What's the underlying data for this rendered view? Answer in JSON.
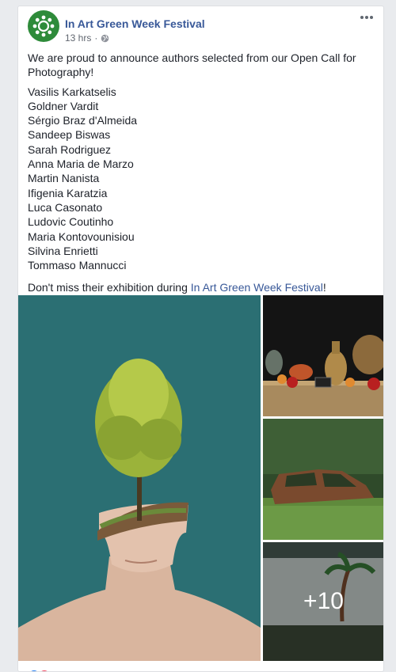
{
  "post": {
    "page_name": "In Art Green Week Festival",
    "time": "13 hrs",
    "separator": "·",
    "privacy_icon": "globe-icon",
    "more_icon": "more-horizontal-icon",
    "intro": "We are proud to announce authors selected from our Open Call for Photography!",
    "authors": [
      "Vasilis Karkatselis",
      "Goldner Vardit",
      "Sérgio Braz d'Almeida",
      "Sandeep Biswas",
      "Sarah Rodriguez",
      "Anna Maria de Marzo",
      "Martin Nanista",
      "Ifigenia Karatzia",
      "Luca Casonato",
      "Ludovic Coutinho",
      "Maria Kontovounisiou",
      "Silvina Enrietti",
      "Tommaso Mannucci"
    ],
    "outro_before": "Don't miss their exhibition during ",
    "outro_link": "In Art Green Week Festival",
    "outro_after": "!"
  },
  "photos": {
    "more_count": "+10"
  },
  "colors": {
    "link": "#385898",
    "brand_green": "#2e8b3a",
    "like_blue": "#1877f2",
    "love_red": "#f33e58"
  }
}
